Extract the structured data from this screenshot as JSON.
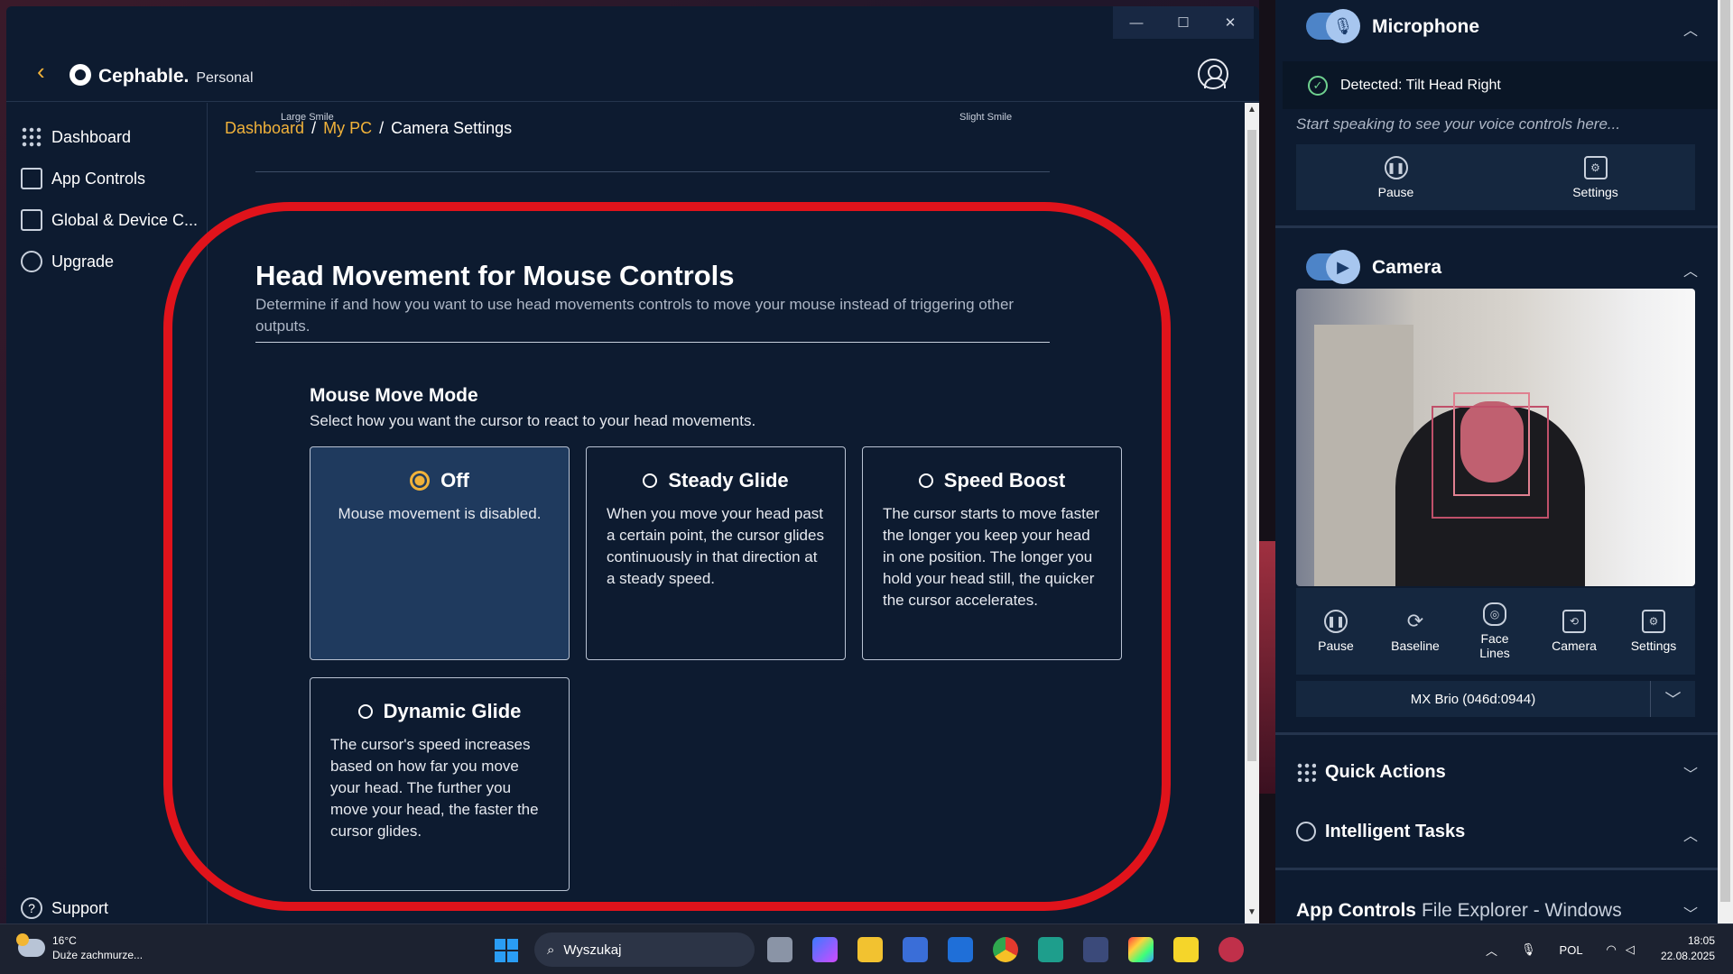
{
  "app": {
    "brand": "Cephable.",
    "plan": "Personal"
  },
  "sidebar": {
    "items": [
      {
        "label": "Dashboard",
        "icon": "grid-icon"
      },
      {
        "label": "App Controls",
        "icon": "list-icon"
      },
      {
        "label": "Global & Device C...",
        "icon": "network-icon"
      },
      {
        "label": "Upgrade",
        "icon": "arrow-up-circle-icon"
      }
    ],
    "support": "Support"
  },
  "breadcrumb": {
    "items": [
      "Dashboard",
      "My PC",
      "Camera Settings"
    ],
    "separator": "/"
  },
  "scrolled_hints": {
    "left": "Large Smile",
    "right": "Slight Smile"
  },
  "section": {
    "title": "Head Movement for Mouse Controls",
    "description": "Determine if and how you want to use head movements controls to move your mouse instead of triggering other outputs."
  },
  "mouse_mode": {
    "title": "Mouse Move Mode",
    "subtitle": "Select how you want the cursor to react to your head movements.",
    "options": [
      {
        "title": "Off",
        "text": "Mouse movement is disabled.",
        "selected": true
      },
      {
        "title": "Steady Glide",
        "text": "When you move your head past a certain point, the cursor glides continuously in that direction at a steady speed.",
        "selected": false
      },
      {
        "title": "Speed Boost",
        "text": "The cursor starts to move faster the longer you keep your head in one position. The longer you hold your head still, the quicker the cursor accelerates.",
        "selected": false
      },
      {
        "title": "Dynamic Glide",
        "text": "The cursor's speed increases based on how far you move your head. The further you move your head, the faster the cursor glides.",
        "selected": false
      }
    ]
  },
  "panel": {
    "microphone": {
      "title": "Microphone",
      "detected": "Detected: Tilt Head Right",
      "hint": "Start speaking to see your voice controls here...",
      "buttons": [
        "Pause",
        "Settings"
      ]
    },
    "camera": {
      "title": "Camera",
      "buttons": [
        "Pause",
        "Baseline",
        "Face Lines",
        "Camera",
        "Settings"
      ],
      "device": "MX Brio (046d:0944)"
    },
    "quick_actions": "Quick Actions",
    "intelligent_tasks": "Intelligent Tasks",
    "app_controls": {
      "label": "App Controls",
      "context": "File Explorer - Windows"
    }
  },
  "taskbar": {
    "weather_temp": "16°C",
    "weather_desc": "Duże zachmurze...",
    "search_placeholder": "Wyszukaj",
    "language": "POL",
    "time": "18:05",
    "date": "22.08.2025"
  },
  "colors": {
    "accent": "#f1b23a",
    "background": "#0d1b30",
    "selected_card": "#1f3a5e",
    "highlight_ring": "#e0131b",
    "success": "#6fd18f"
  }
}
